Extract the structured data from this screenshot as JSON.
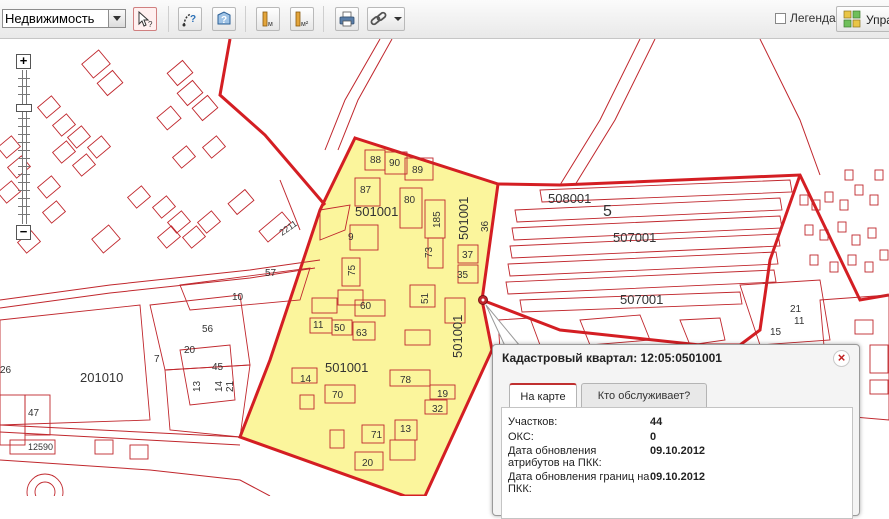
{
  "toolbar": {
    "layer_select_value": "Недвижимость",
    "legend_label": "Легенда",
    "manage_label": "Упра"
  },
  "map": {
    "colors": {
      "parcel_line": "#c0272d",
      "quarter_line": "#d41e23",
      "highlight_fill": "#fbf59c",
      "highlight_border": "#d41e23"
    },
    "labels": {
      "q_501001_top": "501001",
      "q_501001_center": "501001",
      "q_501001_vert_a": "501001",
      "q_501001_vert_b": "501001",
      "q_508001": "508001",
      "n_5": "5",
      "q_507001_a": "507001",
      "q_507001_b": "507001",
      "q_201010": "201010",
      "n_88": "88",
      "n_90": "90",
      "n_89": "89",
      "n_87": "87",
      "n_80": "80",
      "n_185": "185",
      "n_9": "9",
      "n_36": "36",
      "n_73": "73",
      "n_37": "37",
      "n_35": "35",
      "n_75": "75",
      "n_57": "57",
      "n_10": "10",
      "n_60": "60",
      "n_51": "51",
      "n_56": "56",
      "n_11": "11",
      "n_50": "50",
      "n_63": "63",
      "n_20a": "20",
      "n_7": "7",
      "n_45": "45",
      "n_13a": "13",
      "n_14a": "14",
      "n_21": "21",
      "n_14b": "14",
      "n_78": "78",
      "n_19": "19",
      "n_70": "70",
      "n_32": "32",
      "n_47": "47",
      "n_12590": "12590",
      "n_71": "71",
      "n_13b": "13",
      "n_20b": "20",
      "n_2211": "2211",
      "n_26": "26",
      "n_21r": "21",
      "n_11r": "11",
      "n_15r": "15"
    }
  },
  "popup": {
    "title": "Кадастровый квартал: 12:05:0501001",
    "tabs": [
      "На карте",
      "Кто обслуживает?"
    ],
    "rows": [
      {
        "label": "Участков:",
        "value": "44"
      },
      {
        "label": "ОКС:",
        "value": "0"
      },
      {
        "label": "Дата обновления атрибутов на ПКК:",
        "label_lines": [
          "Дата обновления",
          "атрибутов на ПКК:"
        ],
        "value": "09.10.2012"
      },
      {
        "label": "Дата обновления границ на ПКК:",
        "label_lines": [
          "Дата обновления границ на",
          "ПКК:"
        ],
        "value": "09.10.2012"
      }
    ]
  }
}
